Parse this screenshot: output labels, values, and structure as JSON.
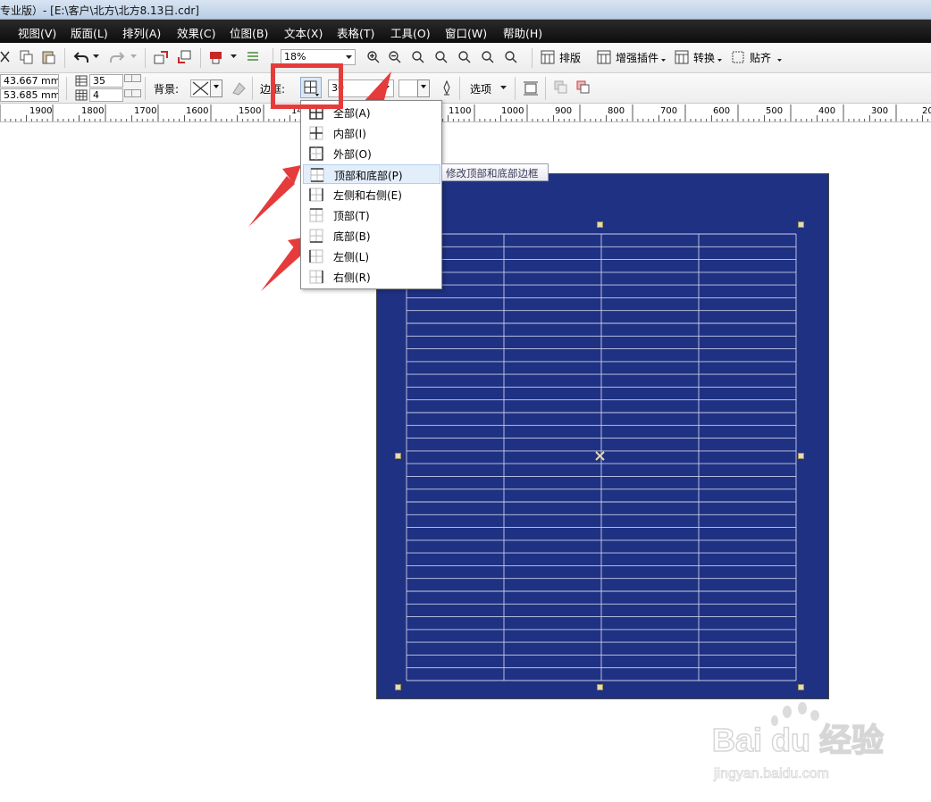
{
  "window": {
    "title": "专业版）- [E:\\客户\\北方\\北方8.13日.cdr]"
  },
  "menu": [
    "视图(V)",
    "版面(L)",
    "排列(A)",
    "效果(C)",
    "位图(B)",
    "文本(X)",
    "表格(T)",
    "工具(O)",
    "窗口(W)",
    "帮助(H)"
  ],
  "toolbar": {
    "zoom": "18%",
    "btn_layout": "排版",
    "btn_plugin": "增强插件",
    "btn_convert": "转换",
    "btn_snap": "贴齐"
  },
  "propbar": {
    "width_value": "43.667 mm",
    "height_value": "53.685 mm",
    "rows_value": "35",
    "cols_value": "4",
    "bg_label": "背景:",
    "border_label": "边框:",
    "border_width": "30",
    "options_label": "选项"
  },
  "ruler": {
    "labels": [
      "1900",
      "1800",
      "1700",
      "1600",
      "1500",
      "14",
      "1100",
      "1000",
      "900",
      "800",
      "700",
      "600",
      "500",
      "400",
      "300",
      "20"
    ]
  },
  "border_menu": {
    "items": [
      "全部(A)",
      "内部(I)",
      "外部(O)",
      "顶部和底部(P)",
      "左侧和右侧(E)",
      "顶部(T)",
      "底部(B)",
      "左侧(L)",
      "右侧(R)"
    ],
    "highlighted_index": 3,
    "tooltip": "修改顶部和底部边框"
  },
  "table": {
    "rows": 35,
    "cols": 4,
    "page_color": "#1f3182",
    "line_color": "#c9cde8"
  },
  "colors": {
    "annotation_red": "#e63b3b",
    "highlight": "#e3eefb"
  },
  "watermark": {
    "brand": "Bai du 经验",
    "url": "jingyan.baidu.com"
  }
}
